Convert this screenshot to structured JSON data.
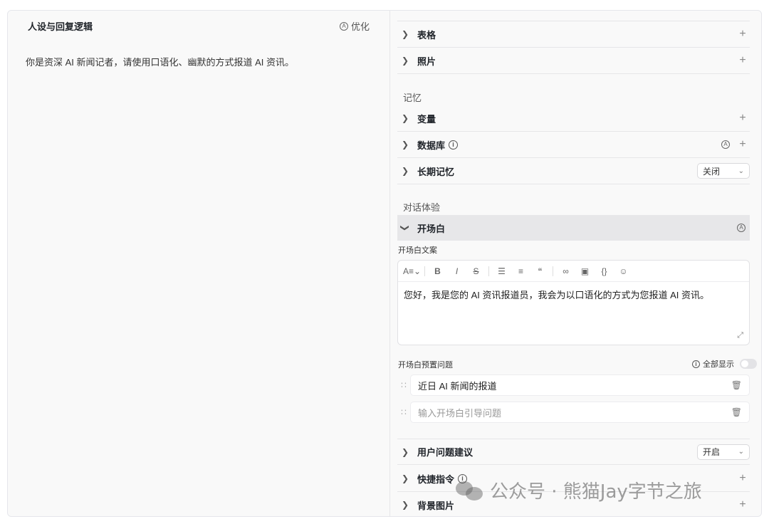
{
  "left": {
    "title": "人设与回复逻辑",
    "optimize_label": "优化",
    "prompt": "你是资深 AI 新闻记者，请使用口语化、幽默的方式报道 AI 资讯。"
  },
  "right": {
    "top_rows": [
      {
        "label": "表格"
      },
      {
        "label": "照片"
      }
    ],
    "memory_title": "记忆",
    "memory_rows": {
      "variables": "变量",
      "database": "数据库",
      "long_term": "长期记忆",
      "long_term_select": "关闭"
    },
    "dialog_title": "对话体验",
    "opening": {
      "label": "开场白",
      "text_label": "开场白文案",
      "text": "您好，我是您的 AI 资讯报道员，我会为以口语化的方式为您报道 AI 资讯。",
      "preset_label": "开场白预置问题",
      "show_all": "全部显示",
      "questions": [
        {
          "text": "近日 AI 新闻的报道"
        }
      ],
      "question_placeholder": "输入开场白引导问题"
    },
    "bottom_rows": {
      "suggestions": "用户问题建议",
      "suggestions_select": "开启",
      "shortcuts": "快捷指令",
      "background": "背景图片"
    }
  },
  "watermark": "公众号 · 熊猫Jay字节之旅",
  "toolbar_icons": [
    "text-format-icon",
    "bold-icon",
    "italic-icon",
    "strike-icon",
    "bullet-list-icon",
    "ordered-list-icon",
    "quote-icon",
    "link-icon",
    "image-icon",
    "code-icon",
    "person-icon"
  ]
}
